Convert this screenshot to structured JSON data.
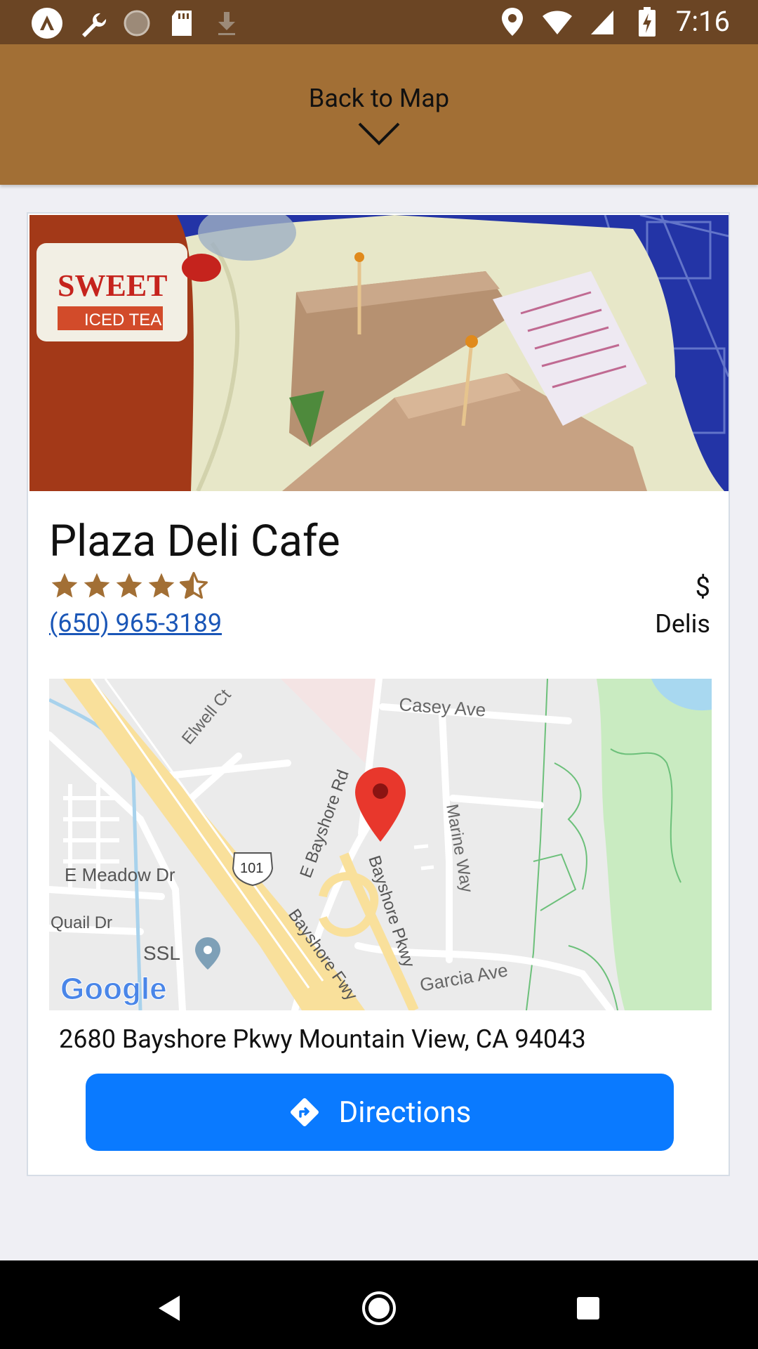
{
  "status_bar": {
    "time": "7:16",
    "left_icons": [
      "app-logo-icon",
      "wrench-icon",
      "sync-icon",
      "sd-card-icon",
      "download-icon"
    ],
    "right_icons": [
      "location-icon",
      "wifi-icon",
      "signal-icon",
      "battery-charging-icon"
    ]
  },
  "header": {
    "back_label": "Back to Map",
    "background_color": "#a26f35",
    "status_bar_color": "#6b4524"
  },
  "place": {
    "name": "Plaza Deli Cafe",
    "rating": 4.5,
    "rating_max": 5,
    "phone": "(650) 965-3189",
    "price": "$",
    "category": "Delis",
    "address": "2680 Bayshore Pkwy Mountain View, CA 94043",
    "photo": "sandwich-photo"
  },
  "map": {
    "labels": {
      "elwell": "Elwell Ct",
      "casey": "Casey Ave",
      "bayshore_rd": "E Bayshore Rd",
      "marine": "Marine Way",
      "meadow": "E Meadow Dr",
      "hwy": "101",
      "quail": "Quail Dr",
      "ssl": "SSL",
      "bayshore_fwy": "Bayshore Fwy",
      "bayshore_pkwy": "Bayshore Pkwy",
      "garcia": "Garcia Ave",
      "google": "Google"
    }
  },
  "directions_button": {
    "label": "Directions",
    "color": "#0a7aff",
    "icon": "directions-icon"
  },
  "nav_bar": {
    "buttons": [
      "back-icon",
      "home-icon",
      "recents-icon"
    ]
  }
}
